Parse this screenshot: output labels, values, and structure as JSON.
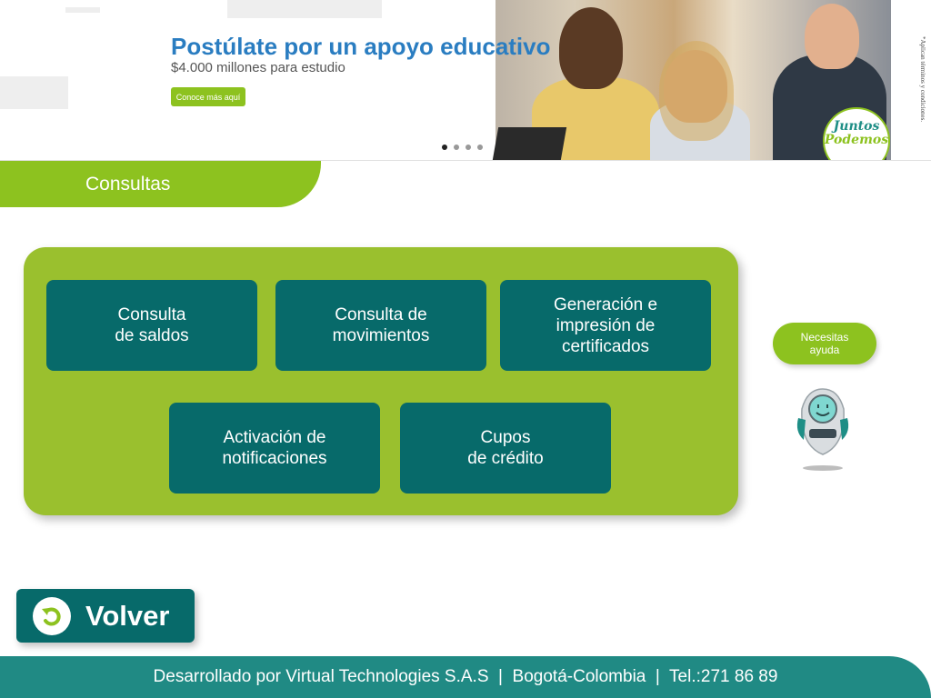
{
  "banner": {
    "title": "Postúlate por un apoyo educativo",
    "subtitle": "$4.000 millones para estudio",
    "cta_label": "Conoce más aquí",
    "legal": "*Aplican términos y condiciones.",
    "badge_line1": "Juntos",
    "badge_line2": "Podemos",
    "carousel": {
      "total_slides": 4,
      "active_slide": 1
    }
  },
  "section": {
    "title": "Consultas"
  },
  "cards": [
    {
      "label": "Consulta\nde saldos"
    },
    {
      "label": "Consulta de\nmovimientos"
    },
    {
      "label": "Generación e\nimpresión de\ncertificados"
    },
    {
      "label": "Activación de\nnotificaciones"
    },
    {
      "label": "Cupos\nde crédito"
    }
  ],
  "help": {
    "label": "Necesitas\nayuda"
  },
  "back": {
    "label": "Volver"
  },
  "footer": {
    "text": "Desarrollado por Virtual Technologies S.A.S  |  Bogotá-Colombia  |  Tel.:271 86 89"
  },
  "colors": {
    "green": "#8dc21f",
    "panel_green": "#9ac02e",
    "teal": "#076a6a",
    "footer_teal": "#208a84",
    "banner_blue": "#2a7dc1"
  },
  "icons": {
    "back": "undo-arrow-icon",
    "help_avatar": "robot-assistant-icon"
  }
}
